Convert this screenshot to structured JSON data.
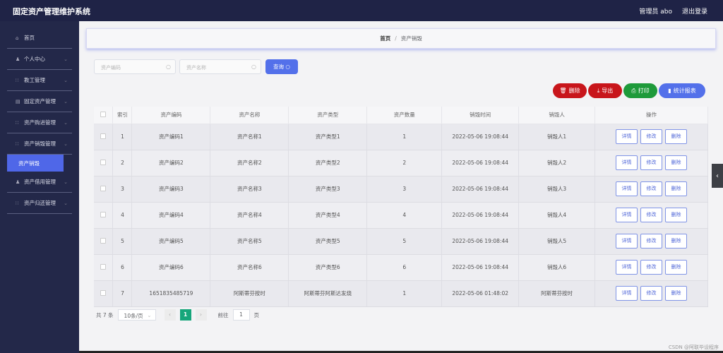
{
  "header": {
    "title": "固定资产管理维护系统",
    "user": "管理员 abo",
    "logout": "退出登录"
  },
  "sidebar": {
    "items": [
      {
        "label": "首页",
        "icon": "home-icon"
      },
      {
        "label": "个人中心",
        "icon": "user-icon"
      },
      {
        "label": "教工管理",
        "icon": "grid-icon"
      },
      {
        "label": "固定资产管理",
        "icon": "doc-icon"
      },
      {
        "label": "资产购进管理",
        "icon": "grid-icon"
      },
      {
        "label": "资产销毁管理",
        "icon": "grid-icon"
      }
    ],
    "active_sub": "资产销毁",
    "items2": [
      {
        "label": "资产借用管理",
        "icon": "user-icon"
      },
      {
        "label": "资产归还管理",
        "icon": "grid-icon"
      }
    ]
  },
  "breadcrumb": {
    "home": "首页",
    "sep": "/",
    "current": "资产销毁"
  },
  "search": {
    "code_placeholder": "资产编码",
    "name_placeholder": "资产名称",
    "query": "查询"
  },
  "actions": {
    "delete": "删除",
    "export": "导出",
    "print": "打印",
    "report": "统计报表"
  },
  "table": {
    "headers": [
      "索引",
      "资产编码",
      "资产名称",
      "资产类型",
      "资产数量",
      "销毁时间",
      "销毁人",
      "操作"
    ],
    "rows": [
      [
        "1",
        "资产编码1",
        "资产名称1",
        "资产类型1",
        "1",
        "2022-05-06 19:08:44",
        "销毁人1"
      ],
      [
        "2",
        "资产编码2",
        "资产名称2",
        "资产类型2",
        "2",
        "2022-05-06 19:08:44",
        "销毁人2"
      ],
      [
        "3",
        "资产编码3",
        "资产名称3",
        "资产类型3",
        "3",
        "2022-05-06 19:08:44",
        "销毁人3"
      ],
      [
        "4",
        "资产编码4",
        "资产名称4",
        "资产类型4",
        "4",
        "2022-05-06 19:08:44",
        "销毁人4"
      ],
      [
        "5",
        "资产编码5",
        "资产名称5",
        "资产类型5",
        "5",
        "2022-05-06 19:08:44",
        "销毁人5"
      ],
      [
        "6",
        "资产编码6",
        "资产名称6",
        "资产类型6",
        "6",
        "2022-05-06 19:08:44",
        "销毁人6"
      ],
      [
        "7",
        "1651835485719",
        "阿斯蒂芬按时",
        "阿斯蒂芬阿斯达发烧",
        "1",
        "2022-05-06 01:48:02",
        "阿斯蒂芬按时"
      ]
    ],
    "ops": {
      "detail": "详情",
      "edit": "修改",
      "delete": "删除"
    }
  },
  "pager": {
    "total": "共 7 条",
    "size": "10条/页",
    "current": "1",
    "goto": "前往",
    "goto_value": "1",
    "page_unit": "页"
  },
  "watermark": "CSDN @阿联毕设程序"
}
